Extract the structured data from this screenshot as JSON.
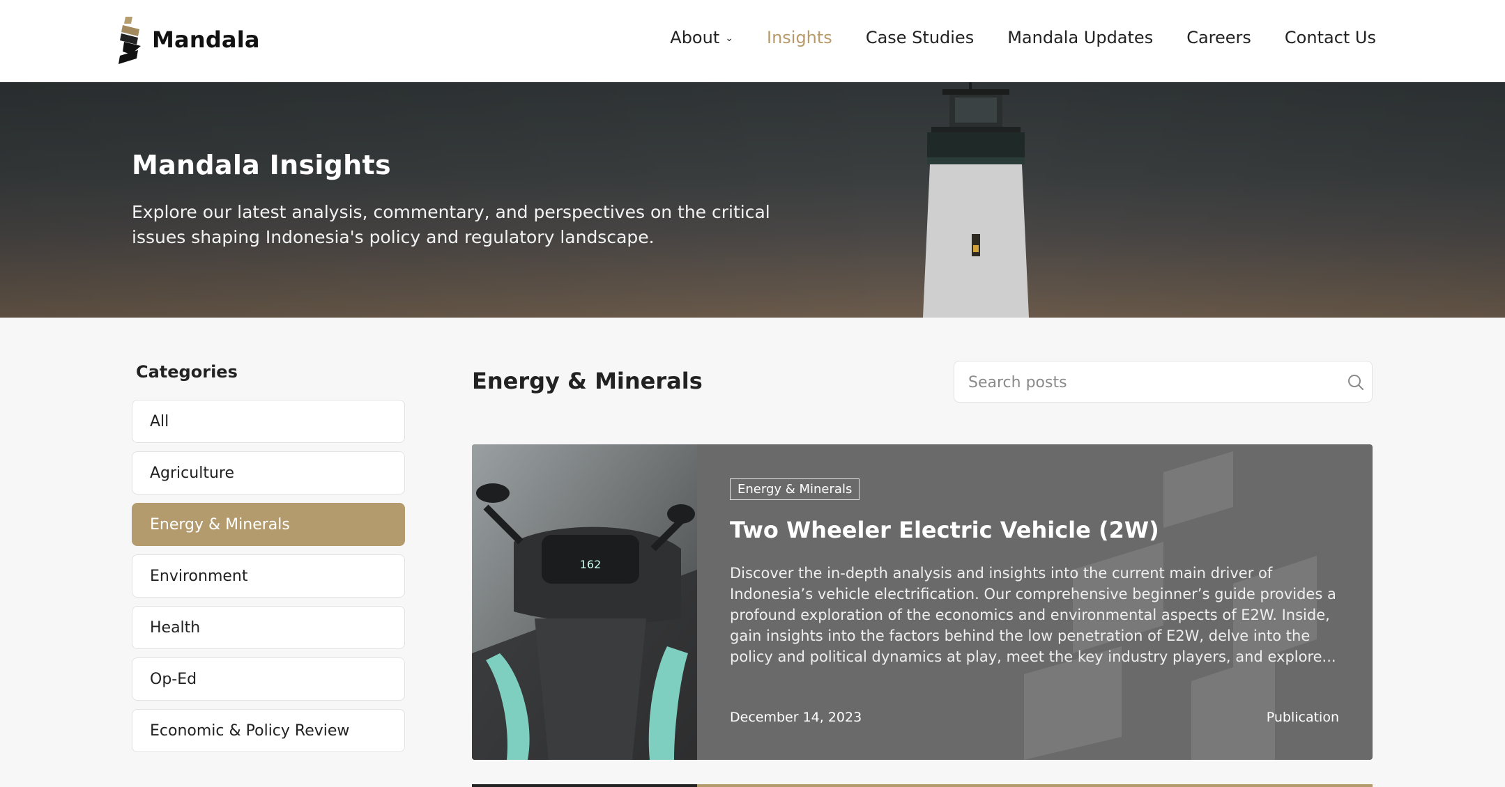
{
  "header": {
    "brand": "Mandala",
    "nav": [
      {
        "label": "About"
      },
      {
        "label": "Insights"
      },
      {
        "label": "Case Studies"
      },
      {
        "label": "Mandala Updates"
      },
      {
        "label": "Careers"
      },
      {
        "label": "Contact Us"
      }
    ]
  },
  "hero": {
    "title": "Mandala Insights",
    "subtitle": "Explore our latest analysis, commentary, and perspectives on the critical issues shaping Indonesia's policy and regulatory landscape."
  },
  "sidebar": {
    "title": "Categories",
    "items": [
      {
        "label": "All"
      },
      {
        "label": "Agriculture"
      },
      {
        "label": "Energy & Minerals"
      },
      {
        "label": "Environment"
      },
      {
        "label": "Health"
      },
      {
        "label": "Op-Ed"
      },
      {
        "label": "Economic & Policy Review"
      }
    ]
  },
  "main": {
    "section_title": "Energy & Minerals",
    "search": {
      "placeholder": "Search posts",
      "value": ""
    },
    "post": {
      "tag": "Energy & Minerals",
      "title": "Two Wheeler Electric Vehicle (2W)",
      "description": "Discover the in-depth analysis and insights into the current main driver of Indonesia’s vehicle electrification. Our comprehensive beginner’s guide provides a profound exploration of the economics and environmental aspects of E2W. Inside, gain insights into the factors behind the low penetration of E2W, delve into the policy and political dynamics at play, meet the key industry players, and explore...",
      "date": "December 14, 2023",
      "type": "Publication",
      "speedometer": "162"
    }
  },
  "colors": {
    "accent": "#b39b6d",
    "nav_active": "#b89a6b",
    "card_bg": "#6a6a6a"
  }
}
